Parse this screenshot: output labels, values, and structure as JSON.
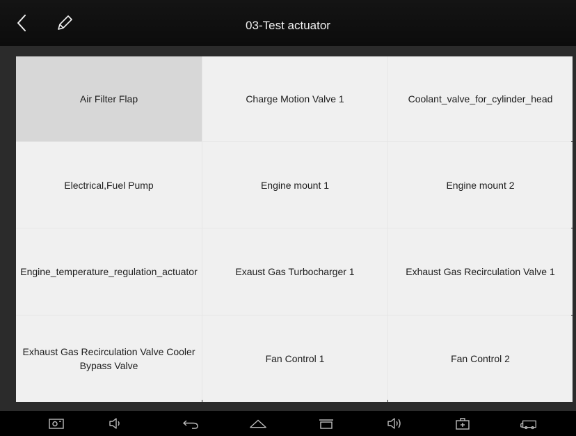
{
  "header": {
    "title": "03-Test actuator",
    "back_icon": "chevron-left-icon",
    "edit_icon": "pencil-icon"
  },
  "actuators": [
    "Air Filter Flap",
    "Charge Motion Valve 1",
    "Coolant_valve_for_cylinder_head",
    "Electrical,Fuel Pump",
    "Engine mount 1",
    "Engine mount 2",
    "Engine_temperature_regulation_actuator",
    "Exaust Gas Turbocharger 1",
    "Exhaust Gas Recirculation Valve 1",
    "Exhaust Gas Recirculation Valve Cooler Bypass Valve",
    "Fan Control 1",
    "Fan Control 2"
  ],
  "selected_index": 0,
  "navbar": {
    "icons": [
      "screenshot-icon",
      "volume-down-icon",
      "back-icon",
      "home-icon",
      "recent-apps-icon",
      "volume-up-icon",
      "diagnostic-toolbox-icon",
      "vci-connector-icon"
    ]
  },
  "colors": {
    "titlebar_bg": "#0c0c0c",
    "cell_bg": "#f0f0f0",
    "cell_selected_bg": "#d7d7d7",
    "content_bg": "#2b2b2b"
  }
}
